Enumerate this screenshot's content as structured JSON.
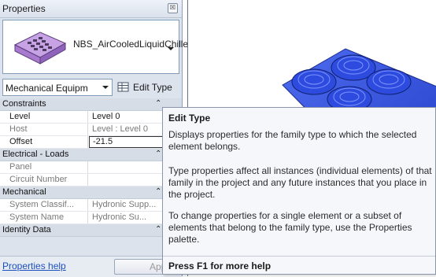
{
  "palette": {
    "title": "Properties",
    "close_glyph": "☒",
    "type_name": "NBS_AirCooledLiquidChillers",
    "instance_filter": "Mechanical Equipm",
    "edit_type_label": "Edit Type",
    "help_link": "Properties help",
    "apply_label": "Apply"
  },
  "groups": [
    {
      "label": "Constraints",
      "params": [
        {
          "name": "Level",
          "value": "Level 0",
          "readonly": false
        },
        {
          "name": "Host",
          "value": "Level : Level 0",
          "readonly": true
        },
        {
          "name": "Offset",
          "value": "-21.5",
          "readonly": false,
          "editing": true
        }
      ]
    },
    {
      "label": "Electrical - Loads",
      "params": [
        {
          "name": "Panel",
          "value": "",
          "readonly": true
        },
        {
          "name": "Circuit Number",
          "value": "",
          "readonly": true
        }
      ]
    },
    {
      "label": "Mechanical",
      "params": [
        {
          "name": "System Classif...",
          "value": "Hydronic Supp...",
          "readonly": true
        },
        {
          "name": "System Name",
          "value": "Hydronic Su...",
          "readonly": true
        }
      ]
    },
    {
      "label": "Identity Data",
      "params": []
    }
  ],
  "icons": {
    "group_toggle": "chevron-up-icon",
    "type_thumbnail": "chiller-thumbnail-icon",
    "edit_type": "edit-type-icon"
  },
  "tooltip": {
    "title": "Edit Type",
    "p1": "Displays properties for the family type to which the selected element belongs.",
    "p2": "Type properties affect all instances (individual elements) of that family in the project and any future instances that you place in the project.",
    "p3": "To change properties for a single element or a subset of elements that belong to the family type, use the Properties palette.",
    "help": "Press F1 for more help"
  },
  "colors": {
    "model_blue": "#2f54e0",
    "palette_bg": "#dce3ed",
    "link": "#1b4fbd"
  }
}
